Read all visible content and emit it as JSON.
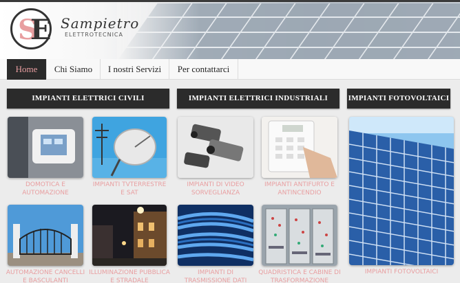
{
  "brand": {
    "name": "Sampietro",
    "subtitle": "ELETTROTECNICA"
  },
  "nav": [
    "Home",
    "Chi Siamo",
    "I nostri Servizi",
    "Per contattarci"
  ],
  "sections": [
    "IMPIANTI ELETTRICI CIVILI",
    "IMPIANTI ELETTRICI INDUSTRIALI",
    "IMPIANTI FOTOVOLTAICI"
  ],
  "tiles": {
    "domotica": "DOMOTICA E AUTOMAZIONE",
    "tv": "IMPIANTI TVTERRESTRE E SAT",
    "video": "IMPIANTI DI VIDEO SORVEGLIANZA",
    "antifurto": "IMPIANTI ANTIFURTO E ANTINCENDIO",
    "cancelli": "AUTOMAZIONE CANCELLI E BASCULANTI",
    "illuminazione": "ILLUMINAZIONE PUBBLICA E STRADALE",
    "trasmissione": "IMPIANTI DI TRASMISSIONE DATI",
    "quadristica": "QUADRISTICA E CABINE DI TRASFORMAZIONE",
    "fotovoltaici": "IMPIANTI FOTOVOLTAICI"
  },
  "colors": {
    "accent": "#e89ea0",
    "dark": "#2b2b2b"
  }
}
